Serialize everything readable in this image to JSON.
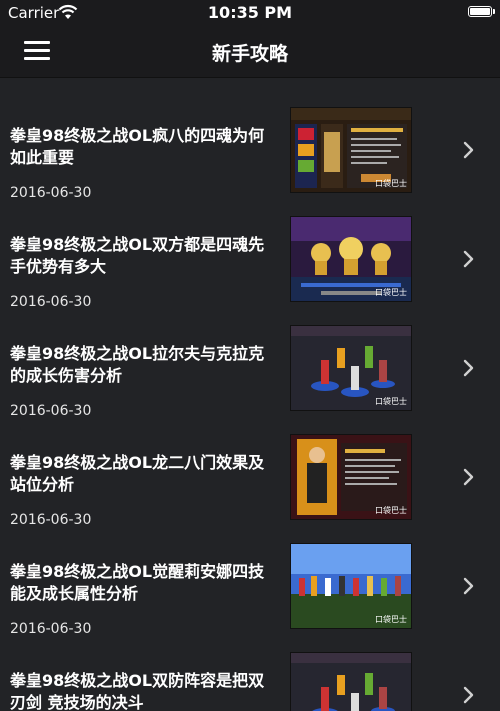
{
  "status_bar": {
    "carrier": "Carrier",
    "time": "10:35 PM"
  },
  "nav": {
    "title": "新手攻略"
  },
  "articles": [
    {
      "title": "拳皇98终极之战OL疯八的四魂为何如此重要",
      "date": "2016-06-30",
      "thumb": "thumb-panel"
    },
    {
      "title": "拳皇98终极之战OL双方都是四魂先手优势有多大",
      "date": "2016-06-30",
      "thumb": "thumb-trophies"
    },
    {
      "title": "拳皇98终极之战OL拉尔夫与克拉克的成长伤害分析",
      "date": "2016-06-30",
      "thumb": "thumb-battle"
    },
    {
      "title": "拳皇98终极之战OL龙二八门效果及站位分析",
      "date": "2016-06-30",
      "thumb": "thumb-character"
    },
    {
      "title": "拳皇98终极之战OL觉醒莉安娜四技能及成长属性分析",
      "date": "2016-06-30",
      "thumb": "thumb-stage"
    },
    {
      "title": "拳皇98终极之战OL双防阵容是把双刃剑 竞技场的决斗",
      "date": "",
      "thumb": "thumb-battle"
    }
  ],
  "thumb_watermark": "口袋巴士",
  "colors": {
    "background": "#222326",
    "bar": "#1b1b1d",
    "text": "#ffffff",
    "chevron": "#d0d0d0"
  }
}
